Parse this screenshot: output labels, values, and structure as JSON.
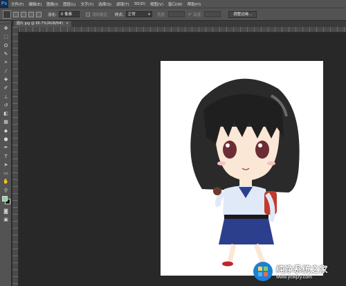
{
  "app": {
    "logo": "Ps"
  },
  "menu": [
    "文件(F)",
    "编辑(E)",
    "图像(I)",
    "图层(L)",
    "文字(Y)",
    "选择(S)",
    "滤镜(T)",
    "3D(D)",
    "视图(V)",
    "窗口(W)",
    "帮助(H)"
  ],
  "options": {
    "feather_label": "羽化:",
    "feather_value": "0 像素",
    "antialias_label": "消除锯齿",
    "style_label": "样式:",
    "style_value": "正常",
    "width_label": "宽度:",
    "height_label": "高度:",
    "refine_edge_button": "调整边缘..."
  },
  "document_tab": {
    "title": "图片.jpg @ 66.7%(RGB/8#)",
    "close": "×"
  },
  "tools": [
    {
      "name": "move-tool-icon",
      "glyph": "✥"
    },
    {
      "name": "rect-marquee-icon",
      "glyph": "⬚"
    },
    {
      "name": "lasso-icon",
      "glyph": "ʘ"
    },
    {
      "name": "quick-select-icon",
      "glyph": "✎"
    },
    {
      "name": "crop-icon",
      "glyph": "⌗"
    },
    {
      "name": "eyedropper-icon",
      "glyph": "⁄"
    },
    {
      "name": "healing-brush-icon",
      "glyph": "✚"
    },
    {
      "name": "brush-icon",
      "glyph": "✐"
    },
    {
      "name": "clone-stamp-icon",
      "glyph": "⊥"
    },
    {
      "name": "history-brush-icon",
      "glyph": "↺"
    },
    {
      "name": "eraser-icon",
      "glyph": "◧"
    },
    {
      "name": "gradient-icon",
      "glyph": "▦"
    },
    {
      "name": "blur-icon",
      "glyph": "◆"
    },
    {
      "name": "dodge-icon",
      "glyph": "●"
    },
    {
      "name": "pen-icon",
      "glyph": "✒"
    },
    {
      "name": "type-icon",
      "glyph": "T"
    },
    {
      "name": "path-select-icon",
      "glyph": "➤"
    },
    {
      "name": "rectangle-shape-icon",
      "glyph": "▭"
    },
    {
      "name": "hand-icon",
      "glyph": "✋"
    },
    {
      "name": "zoom-icon",
      "glyph": "⚲"
    }
  ],
  "colors": {
    "foreground": "#8fd3a0",
    "background": "#000000",
    "accent": "#31a8ff"
  },
  "watermark": {
    "title": "纯净系统之家",
    "url": "www.ycwjzy.com"
  }
}
